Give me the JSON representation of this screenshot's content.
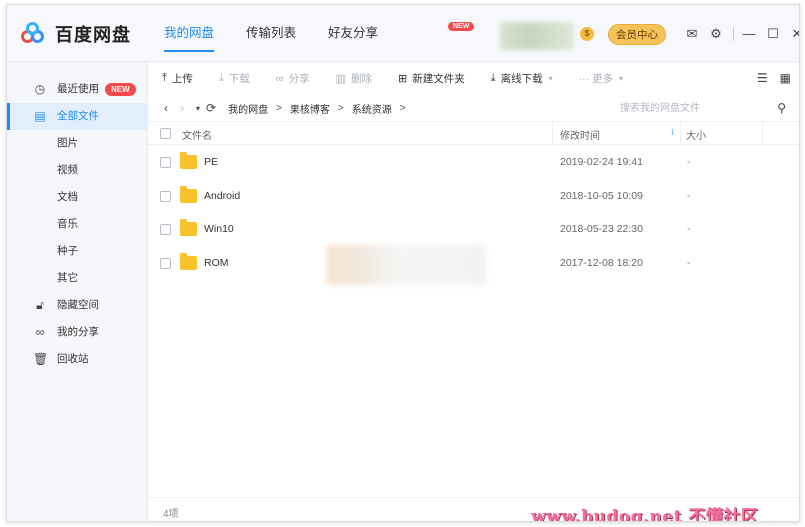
{
  "app": {
    "name": "百度网盘",
    "colors": {
      "accent": "#1c8df4",
      "new_badge": "#f44a4a",
      "vip": "#f6c35a",
      "folder": "#f8c22d"
    }
  },
  "topnav": {
    "tabs": [
      {
        "label": "我的网盘",
        "active": true
      },
      {
        "label": "传输列表",
        "active": false
      },
      {
        "label": "好友分享",
        "active": false
      }
    ],
    "new_badge": "NEW",
    "vip_coin": "$",
    "vip_button": "会员中心",
    "icons": [
      "mail-icon",
      "settings-icon",
      "minimize-icon",
      "maximize-icon",
      "close-icon"
    ]
  },
  "sidebar": {
    "items": [
      {
        "label": "最近使用",
        "icon": "clock-icon",
        "badge": "NEW"
      },
      {
        "label": "全部文件",
        "icon": "document-icon",
        "active": true
      },
      {
        "label": "图片"
      },
      {
        "label": "视频"
      },
      {
        "label": "文档"
      },
      {
        "label": "音乐"
      },
      {
        "label": "种子"
      },
      {
        "label": "其它"
      },
      {
        "label": "隐藏空间",
        "icon": "lock-icon"
      },
      {
        "label": "我的分享",
        "icon": "share-icon"
      },
      {
        "label": "回收站",
        "icon": "trash-icon"
      }
    ]
  },
  "toolbar": {
    "upload": "上传",
    "download": "下载",
    "share": "分享",
    "delete": "删除",
    "new_folder": "新建文件夹",
    "offline_download": "离线下载",
    "more": "··· 更多"
  },
  "pathbar": {
    "crumbs": [
      "我的网盘",
      "果核博客",
      "系统资源"
    ],
    "separator": ">",
    "search_placeholder": "搜索我的网盘文件"
  },
  "table": {
    "headers": {
      "name": "文件名",
      "modified": "修改时间",
      "size": "大小"
    },
    "rows": [
      {
        "name": "PE",
        "modified": "2019-02-24 19:41",
        "size": "-"
      },
      {
        "name": "Android",
        "modified": "2018-10-05 10:09",
        "size": "-"
      },
      {
        "name": "Win10",
        "modified": "2018-05-23 22:30",
        "size": "-"
      },
      {
        "name": "ROM",
        "modified": "2017-12-08 18:20",
        "size": "-"
      }
    ]
  },
  "status": {
    "count": "4项",
    "watermark": "www.budog.net 不懂社区"
  }
}
